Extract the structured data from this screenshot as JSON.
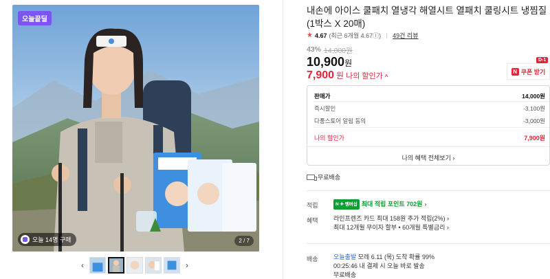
{
  "gallery": {
    "badge": "오늘끝딜",
    "buyers_text": "오늘 14명 구매",
    "page_indicator": "2 / 7",
    "prev_arrow": "‹",
    "next_arrow": "›",
    "thumbnails": [
      "thumb-1",
      "thumb-2",
      "thumb-3",
      "thumb-4",
      "thumb-5"
    ],
    "active_thumbnail": 2
  },
  "product": {
    "title": "내손에 아이스 쿨패치 열냉각 해열시트 열패치 쿨링시트 냉찜질 (1박스 X 20매)",
    "rating_score": "4.67",
    "rating_detail": "(최근 6개월 4.67ⓘ)",
    "review_link": "49건 리뷰",
    "discount_rate": "43%",
    "original_price": "14,000원",
    "sale_price": "10,900",
    "won_unit": "원",
    "my_price": "7,900",
    "my_price_label": "나의 할인가",
    "coupon_tag": "D-1",
    "coupon_logo": "N",
    "coupon_label": "쿠폰 받기"
  },
  "price_breakdown": {
    "rows": [
      {
        "label": "판매가",
        "value": "14,000원"
      },
      {
        "label": "즉시할인",
        "value": "-3,100원"
      },
      {
        "label": "다풍스토어 알림 동의",
        "value": "-3,000원"
      },
      {
        "label": "나의 할인가",
        "value": "7,900원"
      }
    ],
    "view_all": "나의 혜택 전체보기 ›"
  },
  "shipping_short": "무료배송",
  "benefits": {
    "point_label": "적립",
    "npay_badge": "N ✚ 멤버십",
    "point_text": "최대 적립 포인트 702원",
    "benefit_label": "혜택",
    "benefit_line1": "라인프렌즈 카드 최대 158원 추가 적립(2%) ›",
    "benefit_line2": "최대 12개월 무이자 할부 • 60개월 특별금리 ›",
    "delivery_label": "배송",
    "delivery_today": "오늘출발",
    "delivery_line1": "모레 6.11 (목) 도착 확률 99%",
    "delivery_line2": "00:25:46  내 결제 시 오늘 바로 발송",
    "delivery_line3": "무료배송"
  },
  "colors": {
    "accent_purple": "#7a55f3",
    "price_red": "#e2253a",
    "npay_green": "#0a9f2e",
    "link_blue": "#2a63e8"
  }
}
